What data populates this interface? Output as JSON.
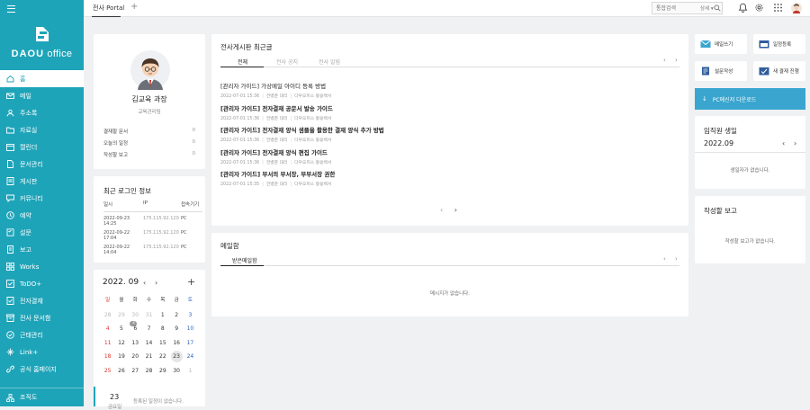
{
  "brand": {
    "name_bold": "DAOU",
    "name_rest": " office"
  },
  "nav": [
    {
      "label": "홈",
      "icon": "home-icon"
    },
    {
      "label": "메일",
      "icon": "mail-icon"
    },
    {
      "label": "주소록",
      "icon": "contacts-icon"
    },
    {
      "label": "자료실",
      "icon": "folder-icon"
    },
    {
      "label": "캘린더",
      "icon": "calendar-icon"
    },
    {
      "label": "문서관리",
      "icon": "document-icon"
    },
    {
      "label": "게시판",
      "icon": "board-icon"
    },
    {
      "label": "커뮤니티",
      "icon": "community-icon"
    },
    {
      "label": "예약",
      "icon": "clock-icon"
    },
    {
      "label": "설문",
      "icon": "survey-icon"
    },
    {
      "label": "보고",
      "icon": "report-icon"
    },
    {
      "label": "Works",
      "icon": "grid-icon"
    },
    {
      "label": "ToDO+",
      "icon": "todo-icon"
    },
    {
      "label": "전자결재",
      "icon": "approval-icon"
    },
    {
      "label": "전사 문서함",
      "icon": "archive-icon"
    },
    {
      "label": "근태관리",
      "icon": "attendance-icon"
    },
    {
      "label": "Link+",
      "icon": "link-icon"
    },
    {
      "label": "공식 홈페이지",
      "icon": "globe-icon"
    }
  ],
  "org_label": "조직도",
  "topbar": {
    "tab": "전사 Portal",
    "search_placeholder": "통합검색",
    "search_scope": "상세 ▾"
  },
  "profile": {
    "name": "김교육 과장",
    "dept": "교육관리팀",
    "stats": [
      {
        "label": "결재할 문서",
        "value": "0"
      },
      {
        "label": "오늘의 일정",
        "value": "0"
      },
      {
        "label": "작성할 보고",
        "value": "0"
      }
    ]
  },
  "login": {
    "title": "최근 로그인 정보",
    "headers": [
      "일시",
      "IP",
      "접속기기"
    ],
    "rows": [
      [
        "2022-09-23 14:25",
        "175.115.92.120",
        "PC"
      ],
      [
        "2022-09-22 17:04",
        "175.115.92.120",
        "PC"
      ],
      [
        "2022-09-22 14:04",
        "175.115.92.120",
        "PC"
      ]
    ]
  },
  "calendar": {
    "month": "2022. 09",
    "dow": [
      "일",
      "월",
      "화",
      "수",
      "목",
      "금",
      "토"
    ],
    "weeks": [
      [
        "28",
        "29",
        "30",
        "31",
        "1",
        "2",
        "3"
      ],
      [
        "4",
        "5",
        "6",
        "7",
        "8",
        "9",
        "10"
      ],
      [
        "11",
        "12",
        "13",
        "14",
        "15",
        "16",
        "17"
      ],
      [
        "18",
        "19",
        "20",
        "21",
        "22",
        "23",
        "24"
      ],
      [
        "25",
        "26",
        "27",
        "28",
        "29",
        "30",
        "1"
      ]
    ],
    "badge_text": "3",
    "today_date": "23",
    "today_dow": "금요일",
    "empty": "등록된 일정이 없습니다."
  },
  "board": {
    "title": "전사게시판 최근글",
    "tabs": [
      "전체",
      "전사 공지",
      "전사 알림"
    ],
    "posts": [
      {
        "title": "[관리자 가이드] 가상메일 아이디 등록 방법",
        "date": "2022-07-01 15:36",
        "author": "전병준 대리",
        "board": "다우오피스 활용백서"
      },
      {
        "title": "[관리자 가이드] 전자결재 공문서 발송 가이드",
        "date": "2022-07-01 15:36",
        "author": "전병준 대리",
        "board": "다우오피스 활용백서"
      },
      {
        "title": "[관리자 가이드] 전자결재 양식 샘플을 활용한 결재 양식 추가 방법",
        "date": "2022-07-01 15:36",
        "author": "전병준 대리",
        "board": "다우오피스 활용백서"
      },
      {
        "title": "[관리자 가이드] 전자결재 양식 편집 가이드",
        "date": "2022-07-01 15:36",
        "author": "전병준 대리",
        "board": "다우오피스 활용백서"
      },
      {
        "title": "[관리자 가이드] 부서의 부서장, 부부서장 권한",
        "date": "2022-07-01 15:35",
        "author": "전병준 대리",
        "board": "다우오피스 활용백서"
      }
    ]
  },
  "mail": {
    "title": "메일함",
    "tab": "받은메일함",
    "empty": "메시지가 없습니다."
  },
  "quick": [
    "메일쓰기",
    "일정등록",
    "설문작성",
    "새 결재 진행"
  ],
  "download": "PC메신저 다운로드",
  "birthday": {
    "title": "임직원 생일",
    "month": "2022.09",
    "empty": "생일자가 없습니다."
  },
  "report": {
    "title": "작성할 보고",
    "empty": "작성할 보고가 없습니다."
  },
  "colors": {
    "accent": "#1ea4b9",
    "download": "#3aa6cf",
    "sunday": "#d9342b",
    "saturday": "#2a5fc1"
  }
}
